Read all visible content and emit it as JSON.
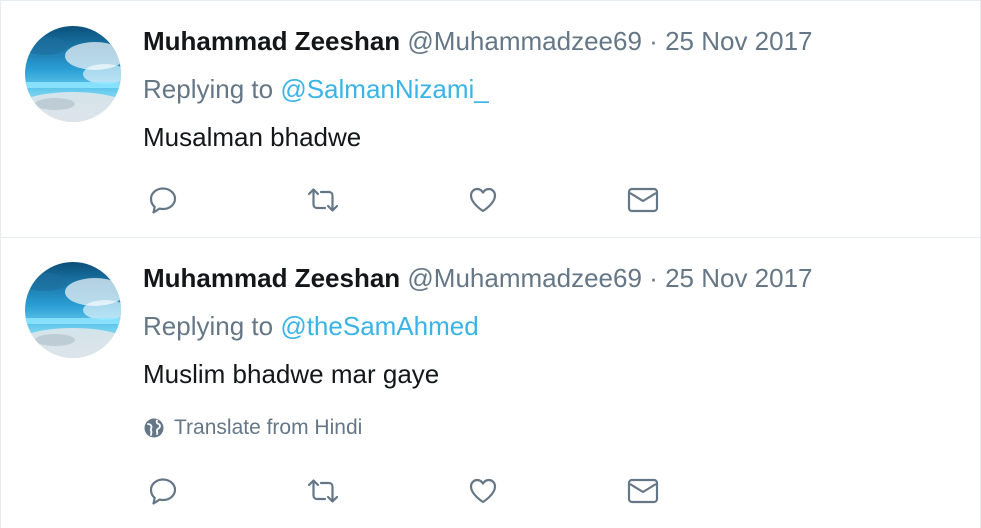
{
  "tweets": [
    {
      "author_name": "Muhammad Zeeshan",
      "author_handle": "@Muhammadzee69",
      "separator": "·",
      "timestamp": "25 Nov 2017",
      "replying_prefix": "Replying to",
      "replying_to": "@SalmanNizami_",
      "text": "Musalman bhadwe",
      "actions": {
        "reply_icon": "reply-icon",
        "retweet_icon": "retweet-icon",
        "like_icon": "heart-icon",
        "dm_icon": "envelope-icon"
      }
    },
    {
      "author_name": "Muhammad Zeeshan",
      "author_handle": "@Muhammadzee69",
      "separator": "·",
      "timestamp": "25 Nov 2017",
      "replying_prefix": "Replying to",
      "replying_to": "@theSamAhmed",
      "text": "Muslim bhadwe mar gaye",
      "translate_label": "Translate from Hindi",
      "actions": {
        "reply_icon": "reply-icon",
        "retweet_icon": "retweet-icon",
        "like_icon": "heart-icon",
        "dm_icon": "envelope-icon"
      }
    }
  ],
  "colors": {
    "text": "#14171a",
    "muted": "#657786",
    "link": "#3ab3e6",
    "divider": "#e6ecf0"
  }
}
